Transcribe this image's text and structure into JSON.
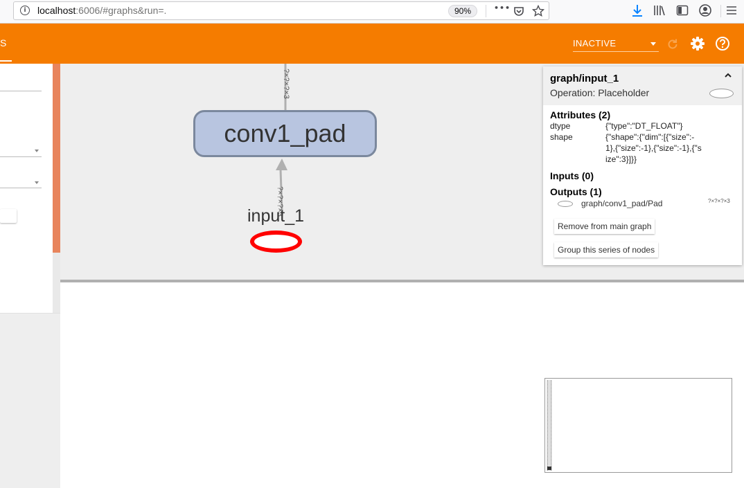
{
  "browser": {
    "url_host": "localhost",
    "url_rest": ":6006/#graphs&run=.",
    "zoom": "90%",
    "more_glyph": "•••"
  },
  "header": {
    "tab_fragment": "S",
    "run_select_value": "INACTIVE",
    "accent_color": "#f57c00"
  },
  "graph": {
    "conv_node_label": "conv1_pad",
    "input_node_label": "input_1",
    "top_edge_label": "?×?×?×3",
    "bottom_edge_label": "?×?×?×3"
  },
  "info_card": {
    "title": "graph/input_1",
    "subtitle": "Operation: Placeholder",
    "attributes_title": "Attributes (2)",
    "attributes": [
      {
        "key": "dtype",
        "value": "{\"type\":\"DT_FLOAT\"}"
      },
      {
        "key": "shape",
        "value": "{\"shape\":{\"dim\":[{\"size\":-1},{\"size\":-1},{\"size\":-1},{\"size\":3}]}}"
      }
    ],
    "inputs_title": "Inputs (0)",
    "outputs_title": "Outputs (1)",
    "outputs": [
      {
        "name": "graph/conv1_pad/Pad",
        "shape": "?×?×?×3"
      }
    ],
    "remove_button": "Remove from main graph",
    "group_button": "Group this series of nodes"
  }
}
